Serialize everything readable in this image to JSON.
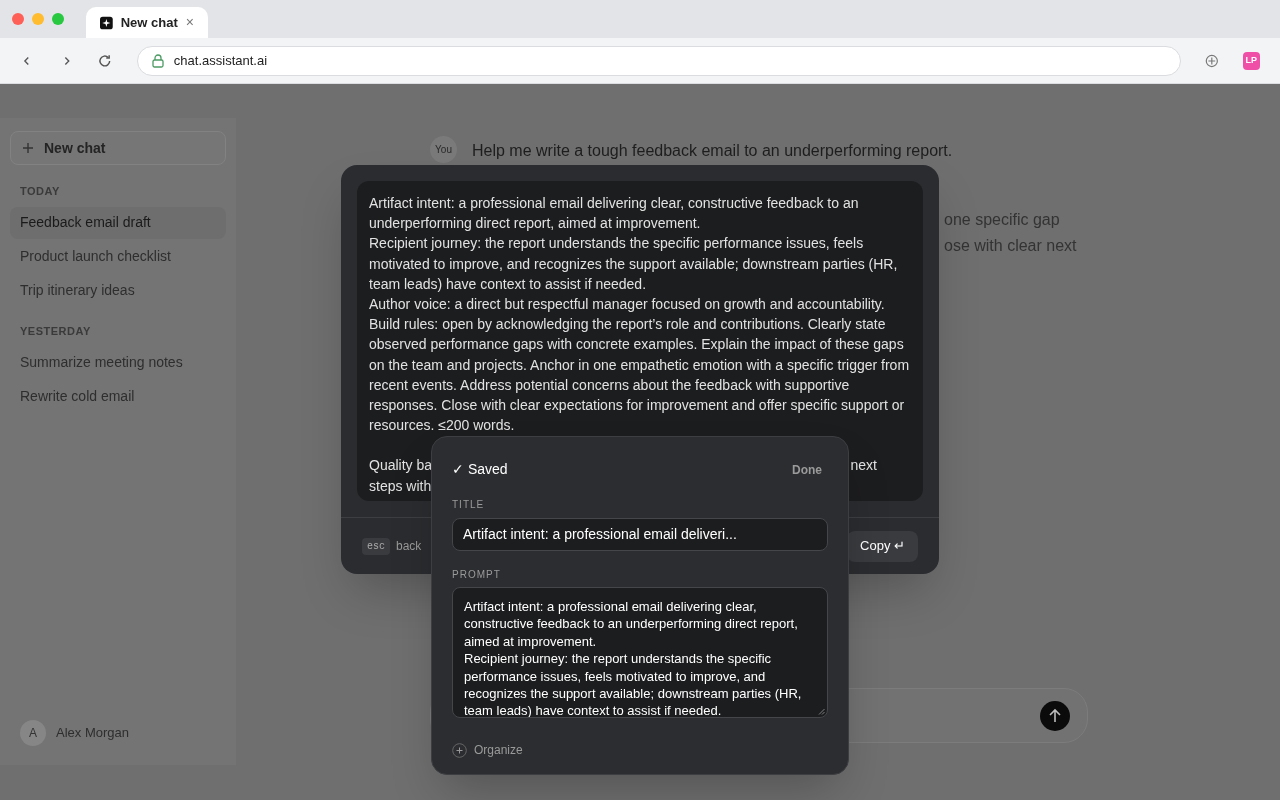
{
  "browser": {
    "tab_title": "New chat",
    "tab_close": "×",
    "url": "chat.assistant.ai",
    "extension_badge": "LP"
  },
  "sidebar": {
    "new_chat": "New chat",
    "sections": [
      {
        "label": "TODAY",
        "items": [
          {
            "label": "Feedback email draft",
            "selected": true
          },
          {
            "label": "Product launch checklist",
            "selected": false
          },
          {
            "label": "Trip itinerary ideas",
            "selected": false
          }
        ]
      },
      {
        "label": "YESTERDAY",
        "items": [
          {
            "label": "Summarize meeting notes",
            "selected": false
          },
          {
            "label": "Rewrite cold email",
            "selected": false
          }
        ]
      }
    ],
    "user": {
      "initial": "A",
      "name": "Alex Morgan"
    }
  },
  "chat": {
    "user_avatar": "You",
    "user_message": "Help me write a tough feedback email to an underperforming report.",
    "assistant_fragments": [
      "one specific gap",
      "ose with clear next"
    ]
  },
  "prompt_viewer": {
    "paragraphs": [
      "Artifact intent: a professional email delivering clear, constructive feedback to an underperforming direct report, aimed at improvement.",
      "Recipient journey: the report understands the specific performance issues, feels motivated to improve, and recognizes the support available; downstream parties (HR, team leads) have context to assist if needed.",
      "Author voice: a direct but respectful manager focused on growth and accountability.",
      "Build rules: open by acknowledging the report’s role and contributions. Clearly state observed performance gaps with concrete examples. Explain the impact of these gaps on the team and projects. Anchor in one empathetic emotion with a specific trigger from recent events. Address potential concerns about the feedback with supportive responses. Close with clear expectations for improvement and offer specific support or resources. ≤200 words."
    ],
    "covered_lines": [
      {
        "left": "Quality ba",
        "right": "next"
      },
      {
        "left": "steps with"
      }
    ],
    "esc_key": "esc",
    "esc_label": "back",
    "copy_button": "Copy ↵"
  },
  "save_popover": {
    "status": "✓ Saved",
    "done": "Done",
    "title_label": "TITLE",
    "title_value": "Artifact intent: a professional email deliveri...",
    "prompt_label": "PROMPT",
    "prompt_paragraphs": [
      "Artifact intent: a professional email delivering clear, constructive feedback to an underperforming direct report, aimed at improvement.",
      "Recipient journey: the report understands the specific performance issues, feels motivated to improve, and recognizes the support available; downstream parties (HR, team leads) have context to assist if needed."
    ],
    "organize": "Organize"
  }
}
